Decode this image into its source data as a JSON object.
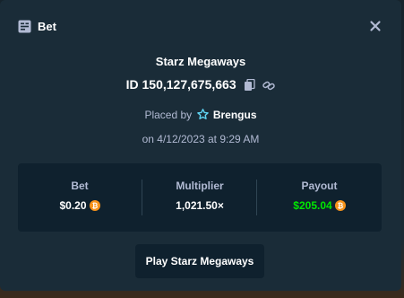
{
  "header": {
    "title": "Bet",
    "icon": "receipt-icon",
    "close_icon": "close-icon"
  },
  "bet": {
    "game_name": "Starz Megaways",
    "id_label": "ID 150,127,675,663",
    "placed_by_prefix": "Placed by",
    "username": "Brengus",
    "date_text": "on 4/12/2023 at 9:29 AM"
  },
  "stats": {
    "bet_label": "Bet",
    "bet_value": "$0.20",
    "multiplier_label": "Multiplier",
    "multiplier_value": "1,021.50×",
    "payout_label": "Payout",
    "payout_value": "$205.04"
  },
  "actions": {
    "play_label": "Play Starz Megaways"
  },
  "colors": {
    "modal_bg": "#1a2c38",
    "panel_bg": "#0f212e",
    "muted_text": "#b1bad3",
    "payout_green": "#00e701",
    "coin_orange": "#f7931a",
    "star_cyan": "#5fd4f3"
  }
}
